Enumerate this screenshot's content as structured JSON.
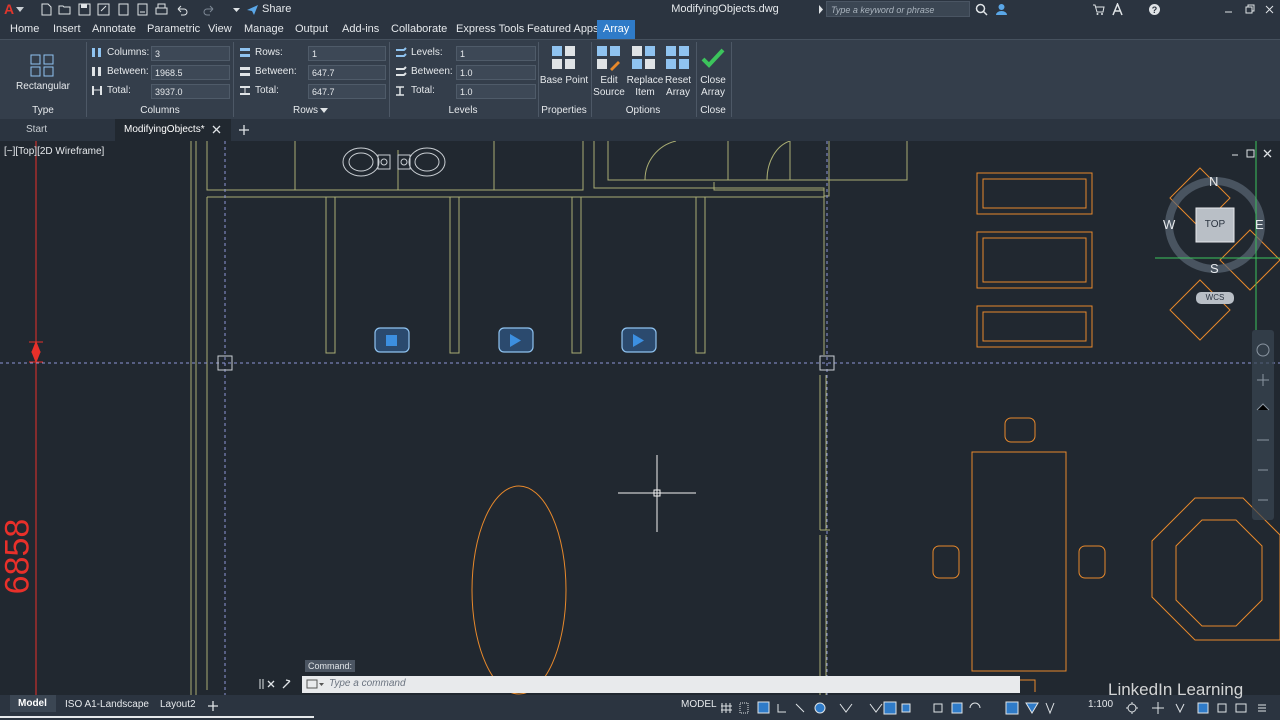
{
  "app": {
    "document_title": "ModifyingObjects.dwg",
    "app_menu_letter": "A",
    "share_label": "Share",
    "search_placeholder": "Type a keyword or phrase"
  },
  "ribbon_tabs": [
    "Home",
    "Insert",
    "Annotate",
    "Parametric",
    "View",
    "Manage",
    "Output",
    "Add-ins",
    "Collaborate",
    "Express Tools",
    "Featured Apps",
    "Array"
  ],
  "active_tab": "Array",
  "ribbon": {
    "type_panel": {
      "button_label": "Rectangular",
      "title": "Type"
    },
    "columns_panel": {
      "title": "Columns",
      "columns_label": "Columns:",
      "columns_value": "3",
      "between_label": "Between:",
      "between_value": "1968.5",
      "total_label": "Total:",
      "total_value": "3937.0"
    },
    "rows_panel": {
      "title": "Rows",
      "rows_label": "Rows:",
      "rows_value": "1",
      "between_label": "Between:",
      "between_value": "647.7",
      "total_label": "Total:",
      "total_value": "647.7"
    },
    "levels_panel": {
      "title": "Levels",
      "levels_label": "Levels:",
      "levels_value": "1",
      "between_label": "Between:",
      "between_value": "1.0",
      "total_label": "Total:",
      "total_value": "1.0"
    },
    "properties_panel": {
      "title": "Properties",
      "base_point_label": "Base Point"
    },
    "options_panel": {
      "title": "Options",
      "edit_source_line1": "Edit",
      "edit_source_line2": "Source",
      "replace_item_line1": "Replace",
      "replace_item_line2": "Item",
      "reset_array_line1": "Reset",
      "reset_array_line2": "Array"
    },
    "close_panel": {
      "title": "Close",
      "close_line1": "Close",
      "close_line2": "Array"
    }
  },
  "file_tabs": {
    "start": "Start",
    "active": "ModifyingObjects*"
  },
  "viewport": {
    "label": "[−][Top][2D Wireframe]",
    "dimension_text": "6858",
    "viewcube": {
      "north": "N",
      "south": "S",
      "east": "E",
      "west": "W",
      "face": "TOP",
      "wcs": "WCS"
    }
  },
  "command": {
    "history": "Command:",
    "placeholder": "Type a command"
  },
  "layout_tabs": [
    "Model",
    "ISO A1-Landscape",
    "Layout2"
  ],
  "status": {
    "mode": "MODEL",
    "scale": "1:100"
  },
  "watermark": "LinkedIn Learning",
  "colors": {
    "accent": "#2f7bc8",
    "drawing_orange": "#e8892b",
    "drawing_olive": "#a9ad73",
    "selection_blue": "#3c8fe0",
    "dimension_red": "#e8302a"
  }
}
